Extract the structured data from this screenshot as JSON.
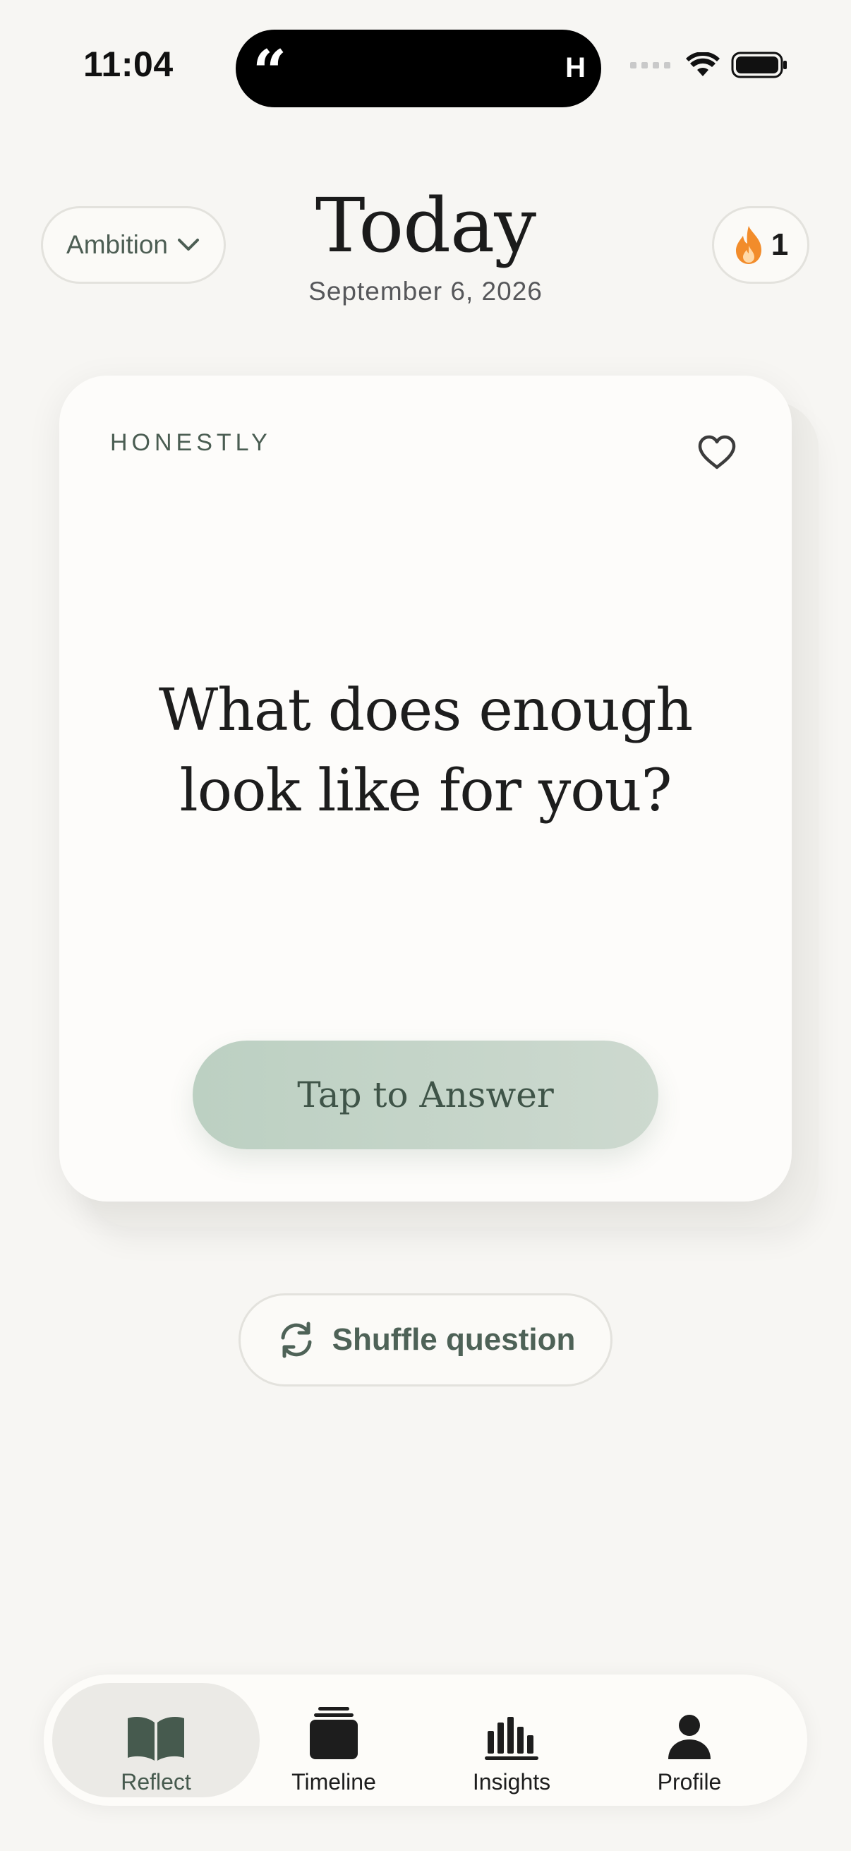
{
  "status_bar": {
    "time": "11:04",
    "island_quote": "“",
    "island_initial": "H"
  },
  "header": {
    "category": "Ambition",
    "title": "Today",
    "date": "September 6, 2026",
    "streak_count": "1"
  },
  "card": {
    "tag": "HONESTLY",
    "question": "What does enough look like for you?",
    "answer_button": "Tap to Answer"
  },
  "shuffle": {
    "label": "Shuffle question"
  },
  "tabs": [
    {
      "label": "Reflect",
      "icon": "book-open-icon",
      "active": true
    },
    {
      "label": "Timeline",
      "icon": "stack-icon",
      "active": false
    },
    {
      "label": "Insights",
      "icon": "bar-chart-icon",
      "active": false
    },
    {
      "label": "Profile",
      "icon": "person-icon",
      "active": false
    }
  ],
  "colors": {
    "background": "#f7f6f3",
    "accent": "#465a4e",
    "answer_button": "#c4d4c8",
    "streak_flame": "#f08a2a"
  }
}
